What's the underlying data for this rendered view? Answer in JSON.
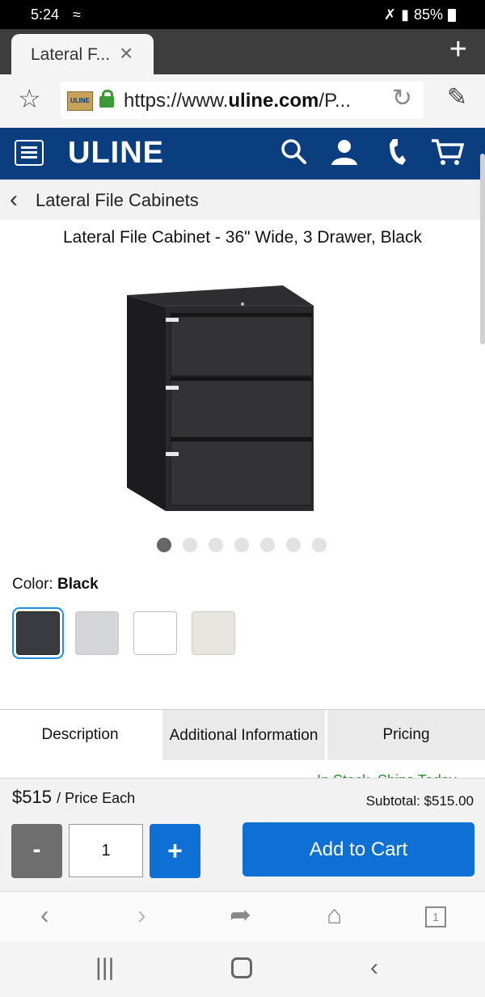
{
  "status": {
    "time": "5:24",
    "battery": "85%"
  },
  "tab": {
    "title": "Lateral F..."
  },
  "address": {
    "url_prefix": "https://www.",
    "url_domain": "uline.com",
    "url_suffix": "/P...",
    "favicon_text": "ULINE"
  },
  "header": {
    "logo": "ULINE"
  },
  "breadcrumb": {
    "label": "Lateral File Cabinets"
  },
  "product": {
    "title": "Lateral File Cabinet - 36\" Wide, 3 Drawer, Black",
    "image_count": 7,
    "active_image": 1,
    "color_label": "Color:",
    "color_value": "Black",
    "swatches": [
      {
        "color": "#3a3b40",
        "selected": true
      },
      {
        "color": "#d3d5d8",
        "selected": false
      },
      {
        "color": "#ffffff",
        "selected": false
      },
      {
        "color": "#e8e5e1",
        "selected": false
      }
    ]
  },
  "tabs": {
    "description": "Description",
    "additional": "Additional Information",
    "pricing": "Pricing"
  },
  "stock": "In Stock, Ships Today",
  "pricing": {
    "price": "$515",
    "per": "/ Price Each",
    "subtotal": "Subtotal: $515.00",
    "minus": "-",
    "qty": "1",
    "plus": "+",
    "add_to_cart": "Add to Cart"
  },
  "browser_nav": {
    "tab_count": "1"
  },
  "colors": {
    "uline_blue": "#0a3e7f",
    "button_blue": "#0e6fd4",
    "stock_green": "#2a8a2a"
  }
}
